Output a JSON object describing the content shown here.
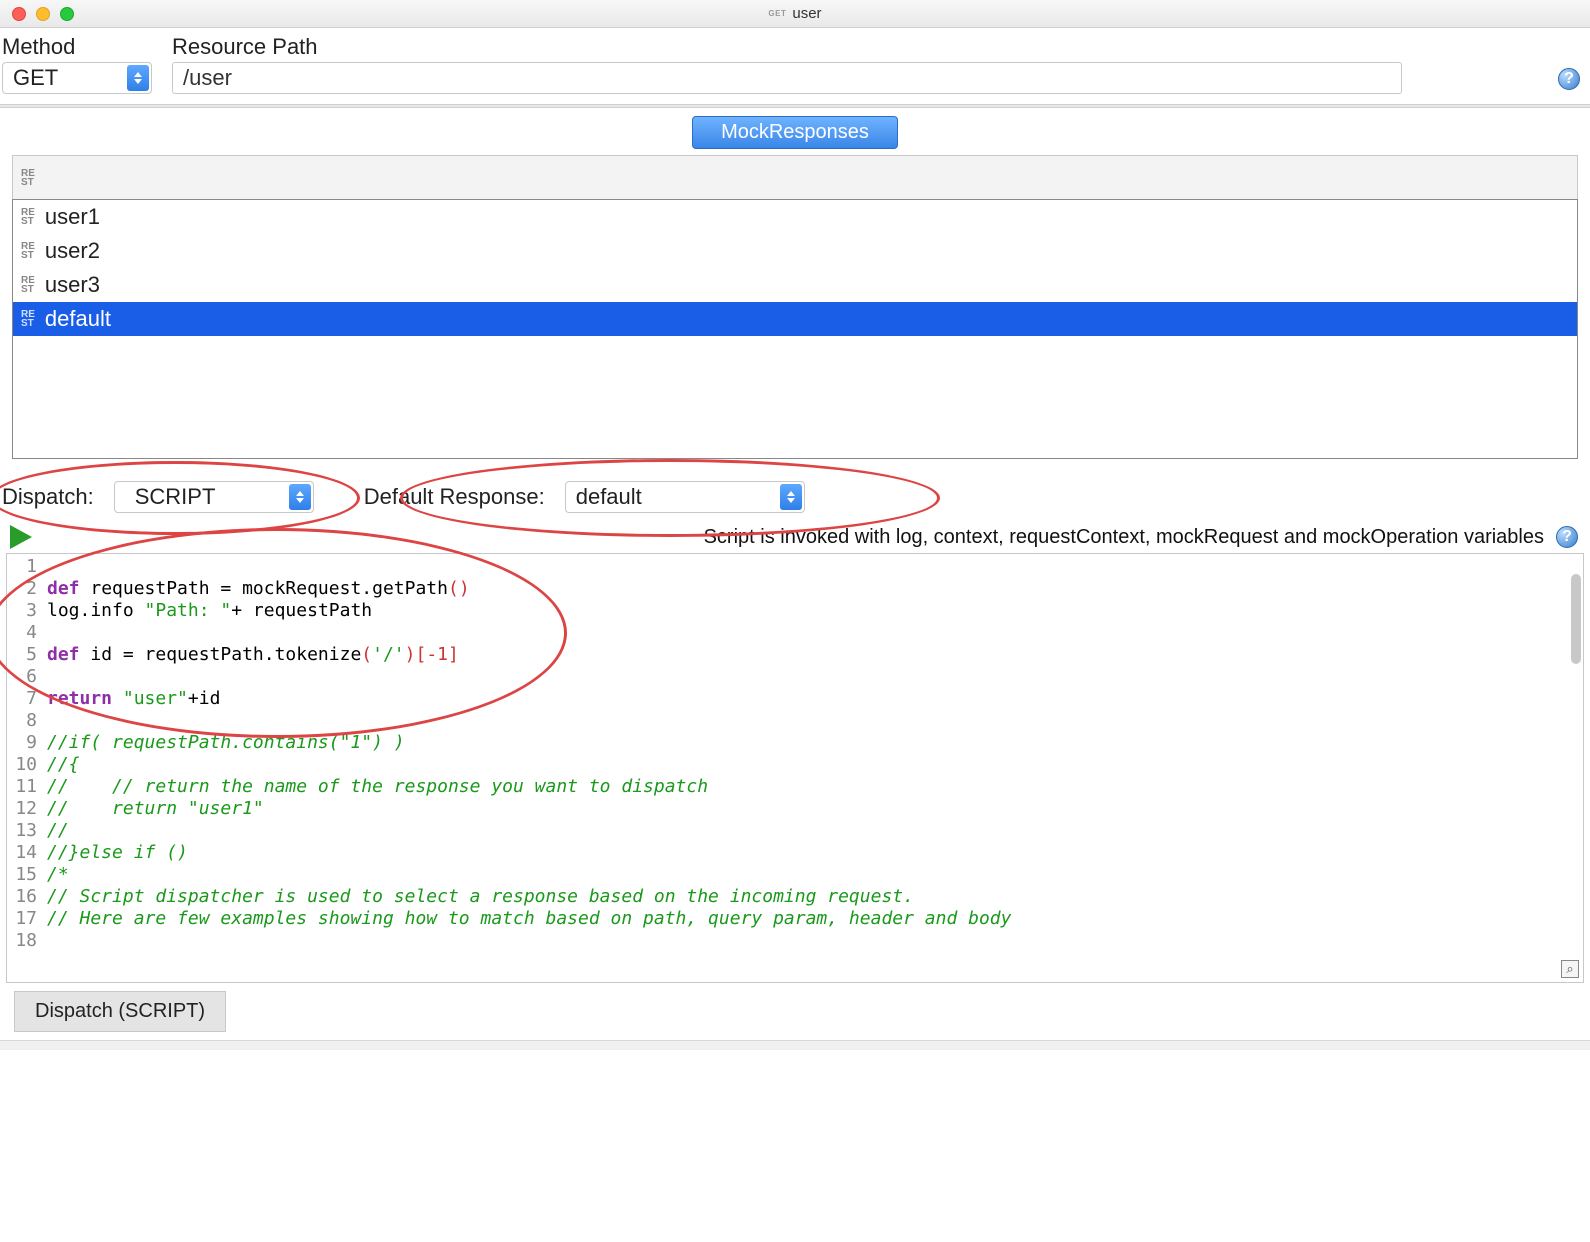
{
  "window": {
    "badge": "GET",
    "title": "user"
  },
  "method": {
    "label": "Method",
    "value": "GET"
  },
  "resource_path": {
    "label": "Resource Path",
    "value": "/user"
  },
  "mock_responses": {
    "tab_label": "MockResponses",
    "items": [
      {
        "label": "user1",
        "selected": false
      },
      {
        "label": "user2",
        "selected": false
      },
      {
        "label": "user3",
        "selected": false
      },
      {
        "label": "default",
        "selected": true
      }
    ]
  },
  "dispatch": {
    "label": "Dispatch:",
    "value": "SCRIPT"
  },
  "default_response": {
    "label": "Default Response:",
    "value": "default"
  },
  "script_hint": "Script is invoked with log, context, requestContext, mockRequest and mockOperation variables",
  "code_lines": [
    {
      "n": 1,
      "tokens": []
    },
    {
      "n": 2,
      "tokens": [
        {
          "t": "def",
          "c": "kw"
        },
        {
          "t": " requestPath = mockRequest.getPath"
        },
        {
          "t": "()",
          "c": "num"
        }
      ]
    },
    {
      "n": 3,
      "tokens": [
        {
          "t": "log.info "
        },
        {
          "t": "\"Path: \"",
          "c": "str"
        },
        {
          "t": "+ requestPath"
        }
      ]
    },
    {
      "n": 4,
      "tokens": []
    },
    {
      "n": 5,
      "tokens": [
        {
          "t": "def",
          "c": "kw"
        },
        {
          "t": " id = requestPath.tokenize"
        },
        {
          "t": "(",
          "c": "num"
        },
        {
          "t": "'/'",
          "c": "str"
        },
        {
          "t": ")[-",
          "c": "num"
        },
        {
          "t": "1",
          "c": "num"
        },
        {
          "t": "]",
          "c": "num"
        }
      ]
    },
    {
      "n": 6,
      "tokens": []
    },
    {
      "n": 7,
      "tokens": [
        {
          "t": "return",
          "c": "kw"
        },
        {
          "t": " "
        },
        {
          "t": "\"user\"",
          "c": "str"
        },
        {
          "t": "+id"
        }
      ]
    },
    {
      "n": 8,
      "tokens": []
    },
    {
      "n": 9,
      "tokens": [
        {
          "t": "//if( requestPath.contains(\"1\") )",
          "c": "com"
        }
      ]
    },
    {
      "n": 10,
      "tokens": [
        {
          "t": "//{",
          "c": "com"
        }
      ]
    },
    {
      "n": 11,
      "tokens": [
        {
          "t": "//    // return the name of the response you want to dispatch",
          "c": "com"
        }
      ]
    },
    {
      "n": 12,
      "tokens": [
        {
          "t": "//    return \"user1\"",
          "c": "com"
        }
      ]
    },
    {
      "n": 13,
      "tokens": [
        {
          "t": "//",
          "c": "com"
        }
      ]
    },
    {
      "n": 14,
      "tokens": [
        {
          "t": "//}else if ()",
          "c": "com"
        }
      ]
    },
    {
      "n": 15,
      "tokens": [
        {
          "t": "/*",
          "c": "com"
        }
      ]
    },
    {
      "n": 16,
      "tokens": [
        {
          "t": "// Script dispatcher is used to select a response based on the incoming request.",
          "c": "com"
        }
      ]
    },
    {
      "n": 17,
      "tokens": [
        {
          "t": "// Here are few examples showing how to match based on path, query param, header and body",
          "c": "com"
        }
      ]
    },
    {
      "n": 18,
      "tokens": []
    }
  ],
  "bottom_tab": "Dispatch (SCRIPT)"
}
